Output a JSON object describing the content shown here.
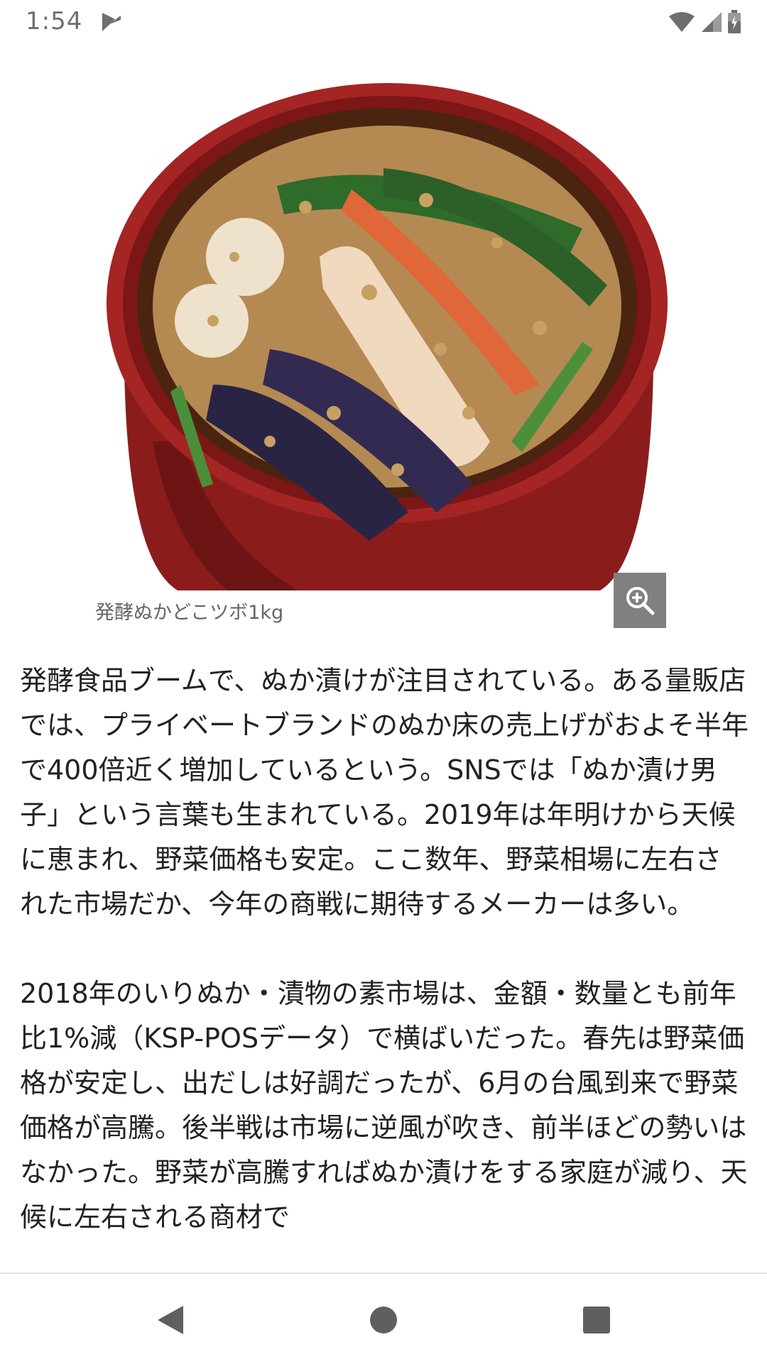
{
  "status_bar": {
    "time": "1:54",
    "icons": [
      "play-store-notification-icon",
      "wifi-icon",
      "signal-icon",
      "battery-icon"
    ]
  },
  "figure": {
    "image_description_icon": "pickle-pot-image",
    "zoom_icon": "zoom-in-icon",
    "caption": "発酵ぬかどこツボ1kg"
  },
  "article": {
    "paragraphs": [
      "発酵食品ブームで、ぬか漬けが注目されている。ある量販店では、プライベートブランドのぬか床の売上げがおよそ半年で400倍近く増加しているという。SNSでは「ぬか漬け男子」という言葉も生まれている。2019年は年明けから天候に恵まれ、野菜価格も安定。ここ数年、野菜相場に左右された市場だか、今年の商戦に期待するメーカーは多い。",
      "2018年のいりぬか・漬物の素市場は、金額・数量とも前年比1%減（KSP-POSデータ）で横ばいだった。春先は野菜価格が安定し、出だしは好調だったが、6月の台風到来で野菜価格が高騰。後半戦は市場に逆風が吹き、前半ほどの勢いはなかった。野菜が高騰すればぬか漬けをする家庭が減り、天候に左右される商材で"
    ]
  },
  "nav_bar": {
    "icons": [
      "back-icon",
      "home-icon",
      "recents-icon"
    ]
  }
}
